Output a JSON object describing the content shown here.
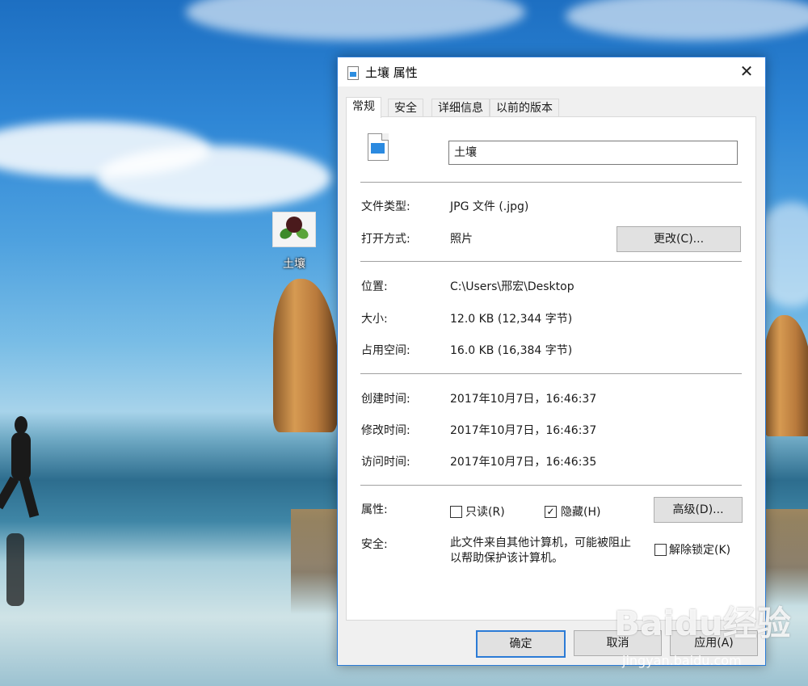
{
  "desktop": {
    "icon_label": "土壤",
    "watermark": "Baidu经验",
    "watermark_url": "jingyan.baidu.com"
  },
  "dialog": {
    "title": "土壤 属性",
    "close_glyph": "✕",
    "tabs": [
      "常规",
      "安全",
      "详细信息",
      "以前的版本"
    ],
    "active_tab": "常规",
    "general": {
      "file_name": "土壤",
      "file_type_label": "文件类型:",
      "file_type_value": "JPG 文件 (.jpg)",
      "opens_with_label": "打开方式:",
      "opens_with_value": "照片",
      "change_button": "更改(C)...",
      "location_label": "位置:",
      "location_value": "C:\\Users\\邢宏\\Desktop",
      "size_label": "大小:",
      "size_value": "12.0 KB (12,344 字节)",
      "size_on_disk_label": "占用空间:",
      "size_on_disk_value": "16.0 KB (16,384 字节)",
      "created_label": "创建时间:",
      "created_value": "2017年10月7日，16:46:37",
      "modified_label": "修改时间:",
      "modified_value": "2017年10月7日，16:46:37",
      "accessed_label": "访问时间:",
      "accessed_value": "2017年10月7日，16:46:35",
      "attributes_label": "属性:",
      "readonly_label": "只读(R)",
      "readonly_checked": false,
      "hidden_label": "隐藏(H)",
      "hidden_checked": true,
      "advanced_button": "高级(D)...",
      "security_label": "安全:",
      "security_text_line1": "此文件来自其他计算机，可能被阻止",
      "security_text_line2": "以帮助保护该计算机。",
      "unblock_label": "解除锁定(K)",
      "unblock_checked": false,
      "check_glyph": "✓"
    },
    "buttons": {
      "ok": "确定",
      "cancel": "取消",
      "apply": "应用(A)"
    }
  }
}
